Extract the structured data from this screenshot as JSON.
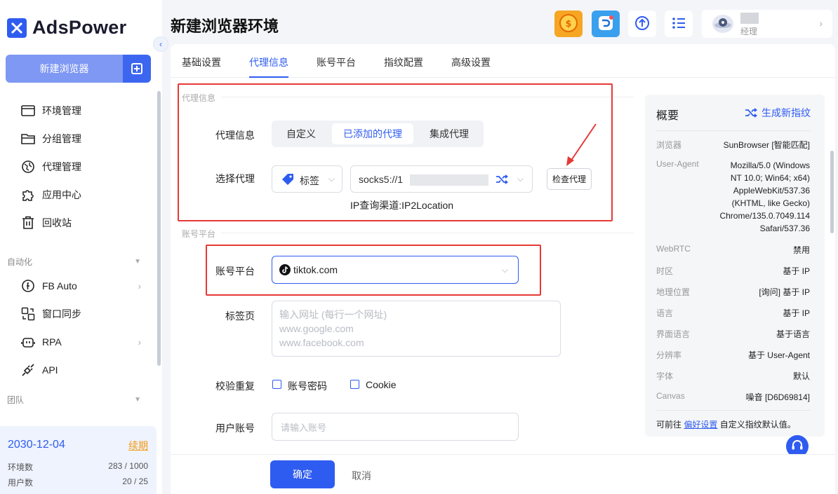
{
  "app": {
    "brand": "AdsPower",
    "title": "新建浏览器环境"
  },
  "sidebar": {
    "new_browser_label": "新建浏览器",
    "items": [
      {
        "label": "环境管理",
        "icon": "browser-window-icon"
      },
      {
        "label": "分组管理",
        "icon": "folder-icon"
      },
      {
        "label": "代理管理",
        "icon": "proxy-globe-icon"
      },
      {
        "label": "应用中心",
        "icon": "puzzle-icon"
      },
      {
        "label": "回收站",
        "icon": "trash-icon"
      }
    ],
    "automation_section": "自动化",
    "automation_items": [
      {
        "label": "FB Auto",
        "icon": "fb-auto-icon"
      },
      {
        "label": "窗口同步",
        "icon": "window-sync-icon"
      },
      {
        "label": "RPA",
        "icon": "rpa-robot-icon"
      },
      {
        "label": "API",
        "icon": "api-plug-icon"
      }
    ],
    "team_section": "团队",
    "plan": {
      "expiry": "2030-12-04",
      "renew": "续期",
      "env_label": "环境数",
      "env_value": "283 / 1000",
      "user_label": "用户数",
      "user_value": "20 / 25"
    }
  },
  "header": {
    "user_role": "经理"
  },
  "tabs": [
    "基础设置",
    "代理信息",
    "账号平台",
    "指纹配置",
    "高级设置"
  ],
  "proxy": {
    "section": "代理信息",
    "label": "代理信息",
    "options": [
      "自定义",
      "已添加的代理",
      "集成代理"
    ],
    "select_label": "选择代理",
    "tag_label": "标签",
    "proxy_value": "socks5://1",
    "check_button": "检查代理",
    "ip_channel": "IP查询渠道:IP2Location"
  },
  "account": {
    "section": "账号平台",
    "label": "账号平台",
    "platform": "tiktok.com",
    "tabs_label": "标签页",
    "tabs_placeholder_1": "输入网址 (每行一个网址)",
    "tabs_placeholder_2": "www.google.com",
    "tabs_placeholder_3": "www.facebook.com",
    "dedup_label": "校验重复",
    "dedup_opt1": "账号密码",
    "dedup_opt2": "Cookie",
    "user_label": "用户账号",
    "user_placeholder": "请输入账号"
  },
  "footer": {
    "confirm": "确定",
    "cancel": "取消"
  },
  "overview": {
    "title": "概要",
    "new_fingerprint": "生成新指纹",
    "rows": [
      {
        "key": "浏览器",
        "value": "SunBrowser [智能匹配]"
      },
      {
        "key": "User-Agent",
        "value": "Mozilla/5.0 (Windows NT 10.0; Win64; x64) AppleWebKit/537.36 (KHTML, like Gecko) Chrome/135.0.7049.114 Safari/537.36"
      },
      {
        "key": "WebRTC",
        "value": "禁用"
      },
      {
        "key": "时区",
        "value": "基于 IP"
      },
      {
        "key": "地理位置",
        "value": "[询问] 基于 IP"
      },
      {
        "key": "语言",
        "value": "基于 IP"
      },
      {
        "key": "界面语言",
        "value": "基于语言"
      },
      {
        "key": "分辨率",
        "value": "基于 User-Agent"
      },
      {
        "key": "字体",
        "value": "默认"
      },
      {
        "key": "Canvas",
        "value": "噪音 [D6D69814]"
      }
    ],
    "foot_prefix": "可前往 ",
    "foot_link": "偏好设置",
    "foot_suffix": " 自定义指纹默认值。"
  },
  "colors": {
    "accent": "#2f5cf0",
    "highlight": "#e53935",
    "renew": "#f29b18"
  }
}
